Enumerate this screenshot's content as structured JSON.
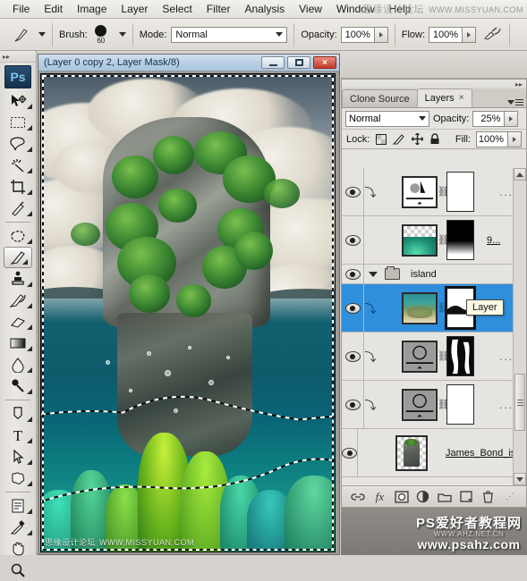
{
  "app": {
    "name": "Adobe Photoshop CS4",
    "logo_text": "Ps"
  },
  "menubar": {
    "items": [
      {
        "label": "File"
      },
      {
        "label": "Edit"
      },
      {
        "label": "Image"
      },
      {
        "label": "Layer"
      },
      {
        "label": "Select"
      },
      {
        "label": "Filter"
      },
      {
        "label": "Analysis"
      },
      {
        "label": "View"
      },
      {
        "label": "Window"
      },
      {
        "label": "Help"
      }
    ]
  },
  "watermarks": {
    "top_cn": "思缘设计论坛",
    "top_url": "WWW.MISSYUAN.COM",
    "bottom_left_cn": "思缘设计论坛",
    "bottom_left_url": "WWW.MISSYUAN.COM",
    "bottom_right_cn": "PS爱好者教程网",
    "bottom_right_faint": "WWW.AHZ.NET.CN",
    "bottom_right_url": "www.psahz.com"
  },
  "options_bar": {
    "tool_preset_name": "brush-tool-preset",
    "brush_label": "Brush:",
    "brush_size": "60",
    "mode_label": "Mode:",
    "mode_value": "Normal",
    "opacity_label": "Opacity:",
    "opacity_value": "100%",
    "flow_label": "Flow:",
    "flow_value": "100%",
    "airbrush_name": "airbrush-toggle"
  },
  "toolbox": {
    "tools": [
      {
        "name": "move-tool",
        "selected": false
      },
      {
        "name": "rectangular-marquee-tool",
        "selected": false
      },
      {
        "name": "lasso-tool",
        "selected": false
      },
      {
        "name": "magic-wand-tool",
        "selected": false
      },
      {
        "name": "crop-tool",
        "selected": false
      },
      {
        "name": "slice-tool",
        "selected": false
      },
      {
        "name": "patch-healing-tool",
        "selected": false
      },
      {
        "name": "brush-tool",
        "selected": true
      },
      {
        "name": "clone-stamp-tool",
        "selected": false
      },
      {
        "name": "history-brush-tool",
        "selected": false
      },
      {
        "name": "eraser-tool",
        "selected": false
      },
      {
        "name": "gradient-tool",
        "selected": false
      },
      {
        "name": "blur-tool",
        "selected": false
      },
      {
        "name": "dodge-tool",
        "selected": false
      },
      {
        "name": "pen-tool",
        "selected": false
      },
      {
        "name": "horizontal-type-tool",
        "selected": false,
        "glyph": "T"
      },
      {
        "name": "path-selection-tool",
        "selected": false
      },
      {
        "name": "custom-shape-tool",
        "selected": false
      },
      {
        "name": "notes-tool",
        "selected": false
      },
      {
        "name": "eyedropper-tool",
        "selected": false
      },
      {
        "name": "hand-tool",
        "selected": false
      },
      {
        "name": "zoom-tool",
        "selected": false
      }
    ]
  },
  "document_window": {
    "title": "(Layer 0 copy 2, Layer Mask/8)",
    "buttons": {
      "minimize": "minimize-button",
      "maximize": "maximize-button",
      "close": "×"
    },
    "artwork_description": "Composite of a limestone karst island above water with coral reef below the waterline, active selection marching ants"
  },
  "layers_panel": {
    "tabs": [
      {
        "label": "Clone Source",
        "active": false
      },
      {
        "label": "Layers",
        "active": true,
        "close_glyph": "×"
      }
    ],
    "blend_mode": "Normal",
    "opacity_label": "Opacity:",
    "opacity_value": "25%",
    "lock_label": "Lock:",
    "lock_icons": [
      "lock-transparent-pixels-icon",
      "lock-image-pixels-icon",
      "lock-position-icon",
      "lock-all-icon"
    ],
    "fill_label": "Fill:",
    "fill_value": "100%",
    "rows": [
      {
        "type": "layer",
        "name": "",
        "dots": "...",
        "visible": true,
        "clipped": true,
        "thumb": "adjustment-levels",
        "mask": "white",
        "selected": false
      },
      {
        "type": "layer",
        "name": "9...",
        "dots": "",
        "visible": true,
        "clipped": false,
        "thumb": "coral-transparent",
        "mask": "gradient-black-white",
        "selected": false
      },
      {
        "type": "group",
        "name": "island",
        "visible": true,
        "expanded": true
      },
      {
        "type": "layer",
        "name": "",
        "dots": "",
        "visible": true,
        "clipped": true,
        "thumb": "reef-photo",
        "mask": "white-with-black-wave",
        "selected": true
      },
      {
        "type": "layer",
        "name": "",
        "dots": "...",
        "visible": true,
        "clipped": true,
        "thumb": "adjustment-curves",
        "mask": "black-with-white-strokes",
        "selected": false
      },
      {
        "type": "layer",
        "name": "",
        "dots": "...",
        "visible": true,
        "clipped": true,
        "thumb": "adjustment-curves",
        "mask": "white",
        "selected": false
      },
      {
        "type": "layer",
        "name": "James_Bond_isla...",
        "dots": "",
        "visible": true,
        "clipped": false,
        "thumb": "island-cutout",
        "mask": null,
        "selected": false
      }
    ],
    "bottom_icons": [
      {
        "name": "link-layers-icon",
        "glyph": "⊂⊃"
      },
      {
        "name": "layer-style-fx-icon",
        "glyph": "fx"
      },
      {
        "name": "add-layer-mask-icon",
        "glyph": "◎"
      },
      {
        "name": "new-adjustment-layer-icon",
        "glyph": "◑"
      },
      {
        "name": "new-group-icon",
        "glyph": "▭"
      },
      {
        "name": "new-layer-icon",
        "glyph": "▣"
      },
      {
        "name": "delete-layer-icon",
        "glyph": "🗑"
      }
    ]
  },
  "tooltip": {
    "text": "Layer"
  },
  "colors": {
    "selection_blue": "#2f8fdd",
    "panel_gray": "#e6e4e0",
    "chrome_gray": "#d6d3ce",
    "close_red": "#c13a23",
    "ps_logo_blue": "#2a4f73",
    "title_blue": "#b9cfe4"
  }
}
